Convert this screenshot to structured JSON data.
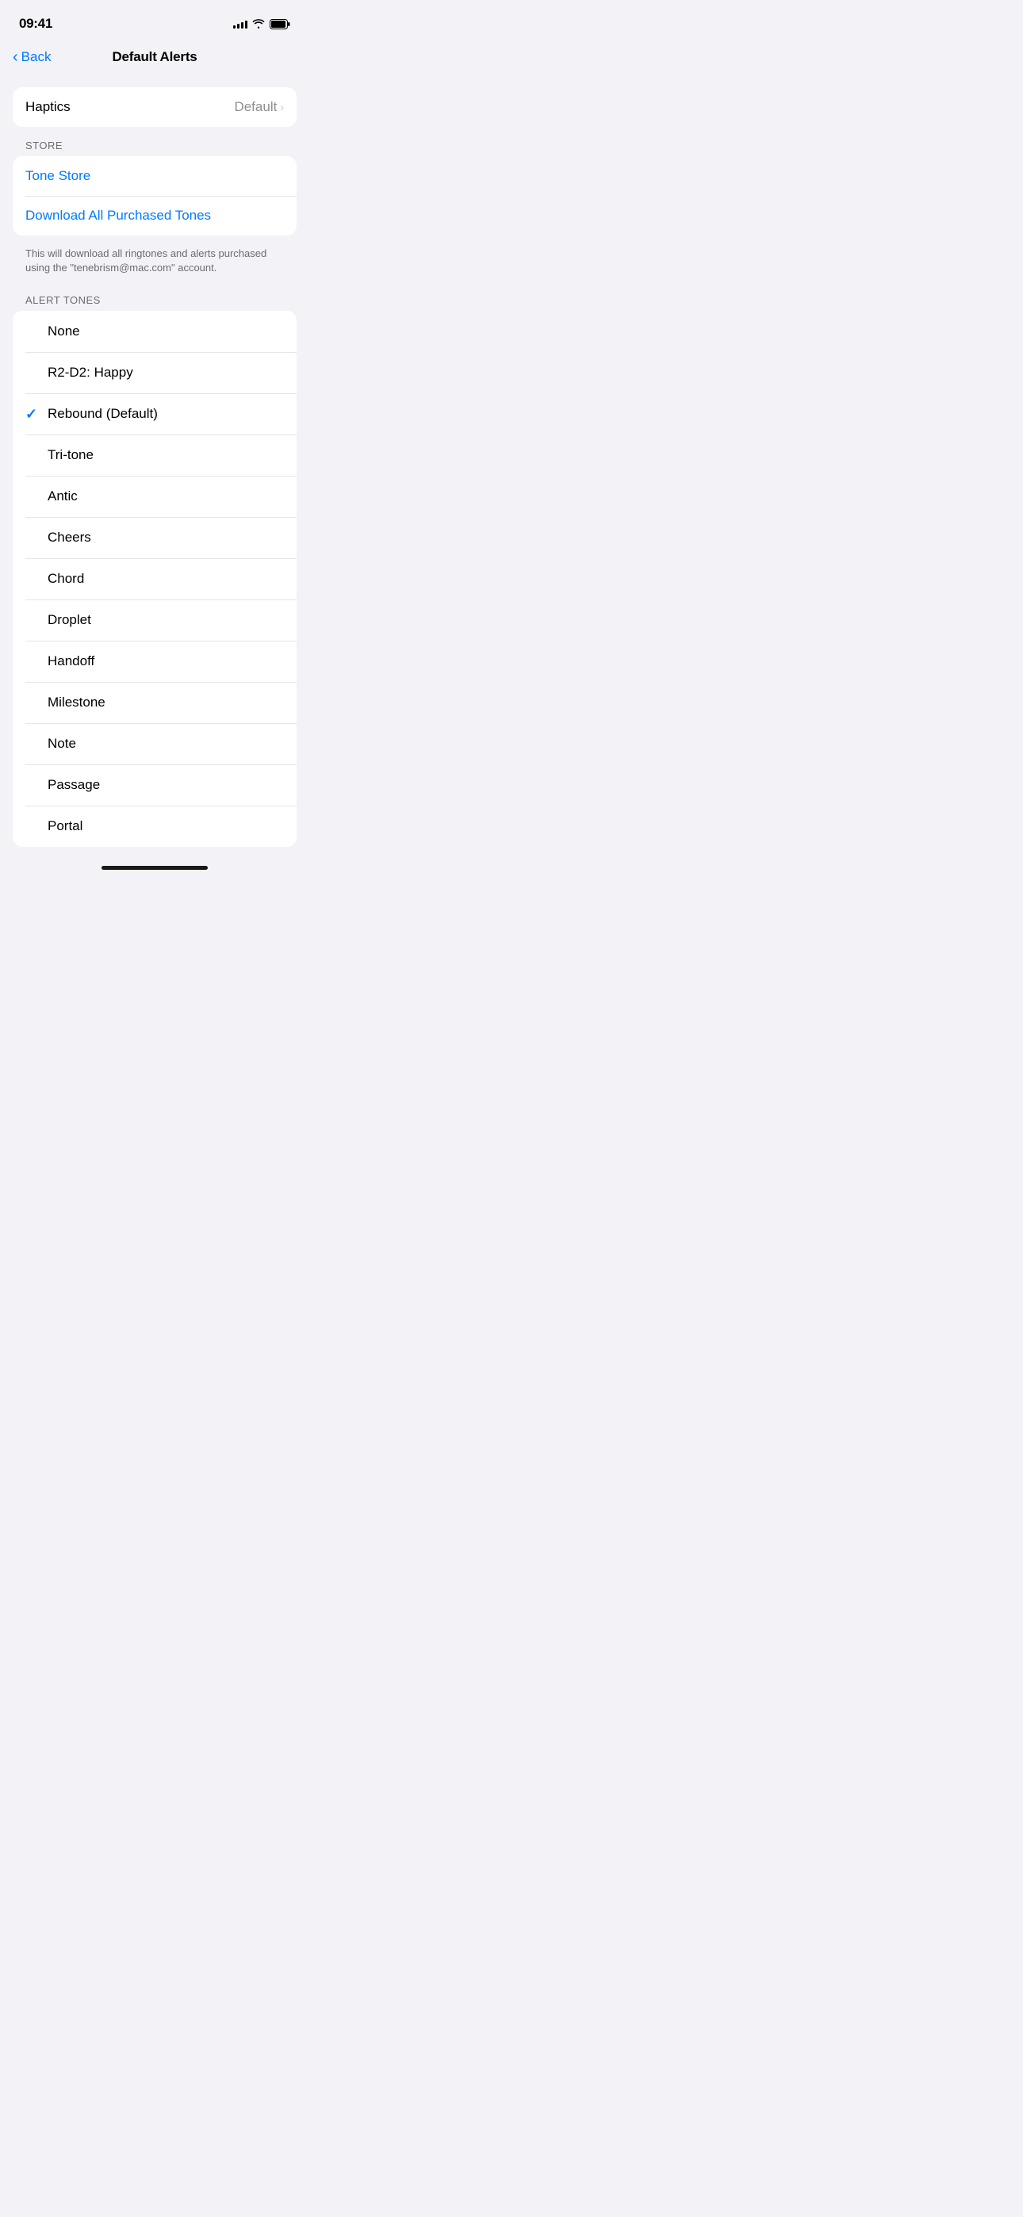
{
  "statusBar": {
    "time": "09:41",
    "signalBars": [
      4,
      6,
      8,
      10,
      12
    ],
    "wifiLabel": "wifi",
    "batteryLabel": "battery"
  },
  "navBar": {
    "backLabel": "Back",
    "title": "Default Alerts"
  },
  "haptics": {
    "label": "Haptics",
    "value": "Default"
  },
  "store": {
    "sectionHeader": "STORE",
    "toneStoreLabel": "Tone Store",
    "downloadLabel": "Download All Purchased Tones",
    "footerText": "This will download all ringtones and alerts purchased using the \"tenebrism@mac.com\" account."
  },
  "alertTones": {
    "sectionHeader": "ALERT TONES",
    "tones": [
      {
        "id": "none",
        "name": "None",
        "selected": false
      },
      {
        "id": "r2d2-happy",
        "name": "R2-D2: Happy",
        "selected": false
      },
      {
        "id": "rebound",
        "name": "Rebound (Default)",
        "selected": true
      },
      {
        "id": "tri-tone",
        "name": "Tri-tone",
        "selected": false
      },
      {
        "id": "antic",
        "name": "Antic",
        "selected": false
      },
      {
        "id": "cheers",
        "name": "Cheers",
        "selected": false
      },
      {
        "id": "chord",
        "name": "Chord",
        "selected": false
      },
      {
        "id": "droplet",
        "name": "Droplet",
        "selected": false
      },
      {
        "id": "handoff",
        "name": "Handoff",
        "selected": false
      },
      {
        "id": "milestone",
        "name": "Milestone",
        "selected": false
      },
      {
        "id": "note",
        "name": "Note",
        "selected": false
      },
      {
        "id": "passage",
        "name": "Passage",
        "selected": false
      },
      {
        "id": "portal",
        "name": "Portal",
        "selected": false
      }
    ]
  },
  "colors": {
    "blue": "#007AFF",
    "background": "#f2f2f7",
    "white": "#ffffff",
    "separator": "#e5e5ea",
    "secondaryText": "#8e8e93",
    "sectionHeaderText": "#6c6c70"
  }
}
